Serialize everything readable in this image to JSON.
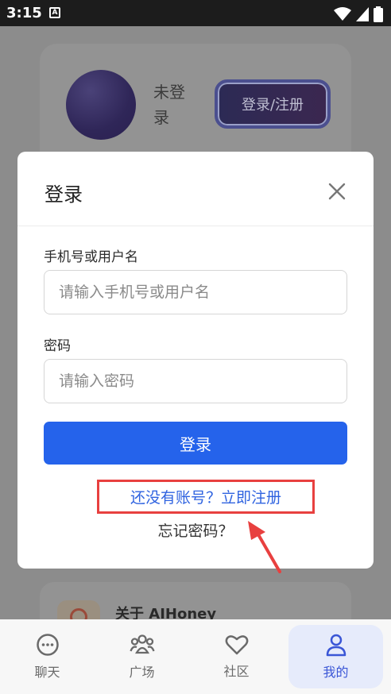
{
  "status_bar": {
    "time": "3:15",
    "notif_glyph": "A"
  },
  "profile": {
    "status_text": "未登录",
    "login_register_label": "登录/注册"
  },
  "about": {
    "title": "关于 AIHoney"
  },
  "bottom_nav": {
    "items": [
      {
        "label": "聊天",
        "icon": "chat-icon"
      },
      {
        "label": "广场",
        "icon": "group-icon"
      },
      {
        "label": "社区",
        "icon": "heart-icon"
      },
      {
        "label": "我的",
        "icon": "user-icon",
        "active": true
      }
    ]
  },
  "modal": {
    "title": "登录",
    "username_label": "手机号或用户名",
    "username_placeholder": "请输入手机号或用户名",
    "password_label": "密码",
    "password_placeholder": "请输入密码",
    "submit_label": "登录",
    "register_link": "还没有账号？立即注册",
    "forgot_link": "忘记密码？"
  },
  "colors": {
    "primary": "#2563eb",
    "highlight_box": "#e8403f",
    "link": "#2f63e0",
    "nav_active": "#3a56d6"
  }
}
